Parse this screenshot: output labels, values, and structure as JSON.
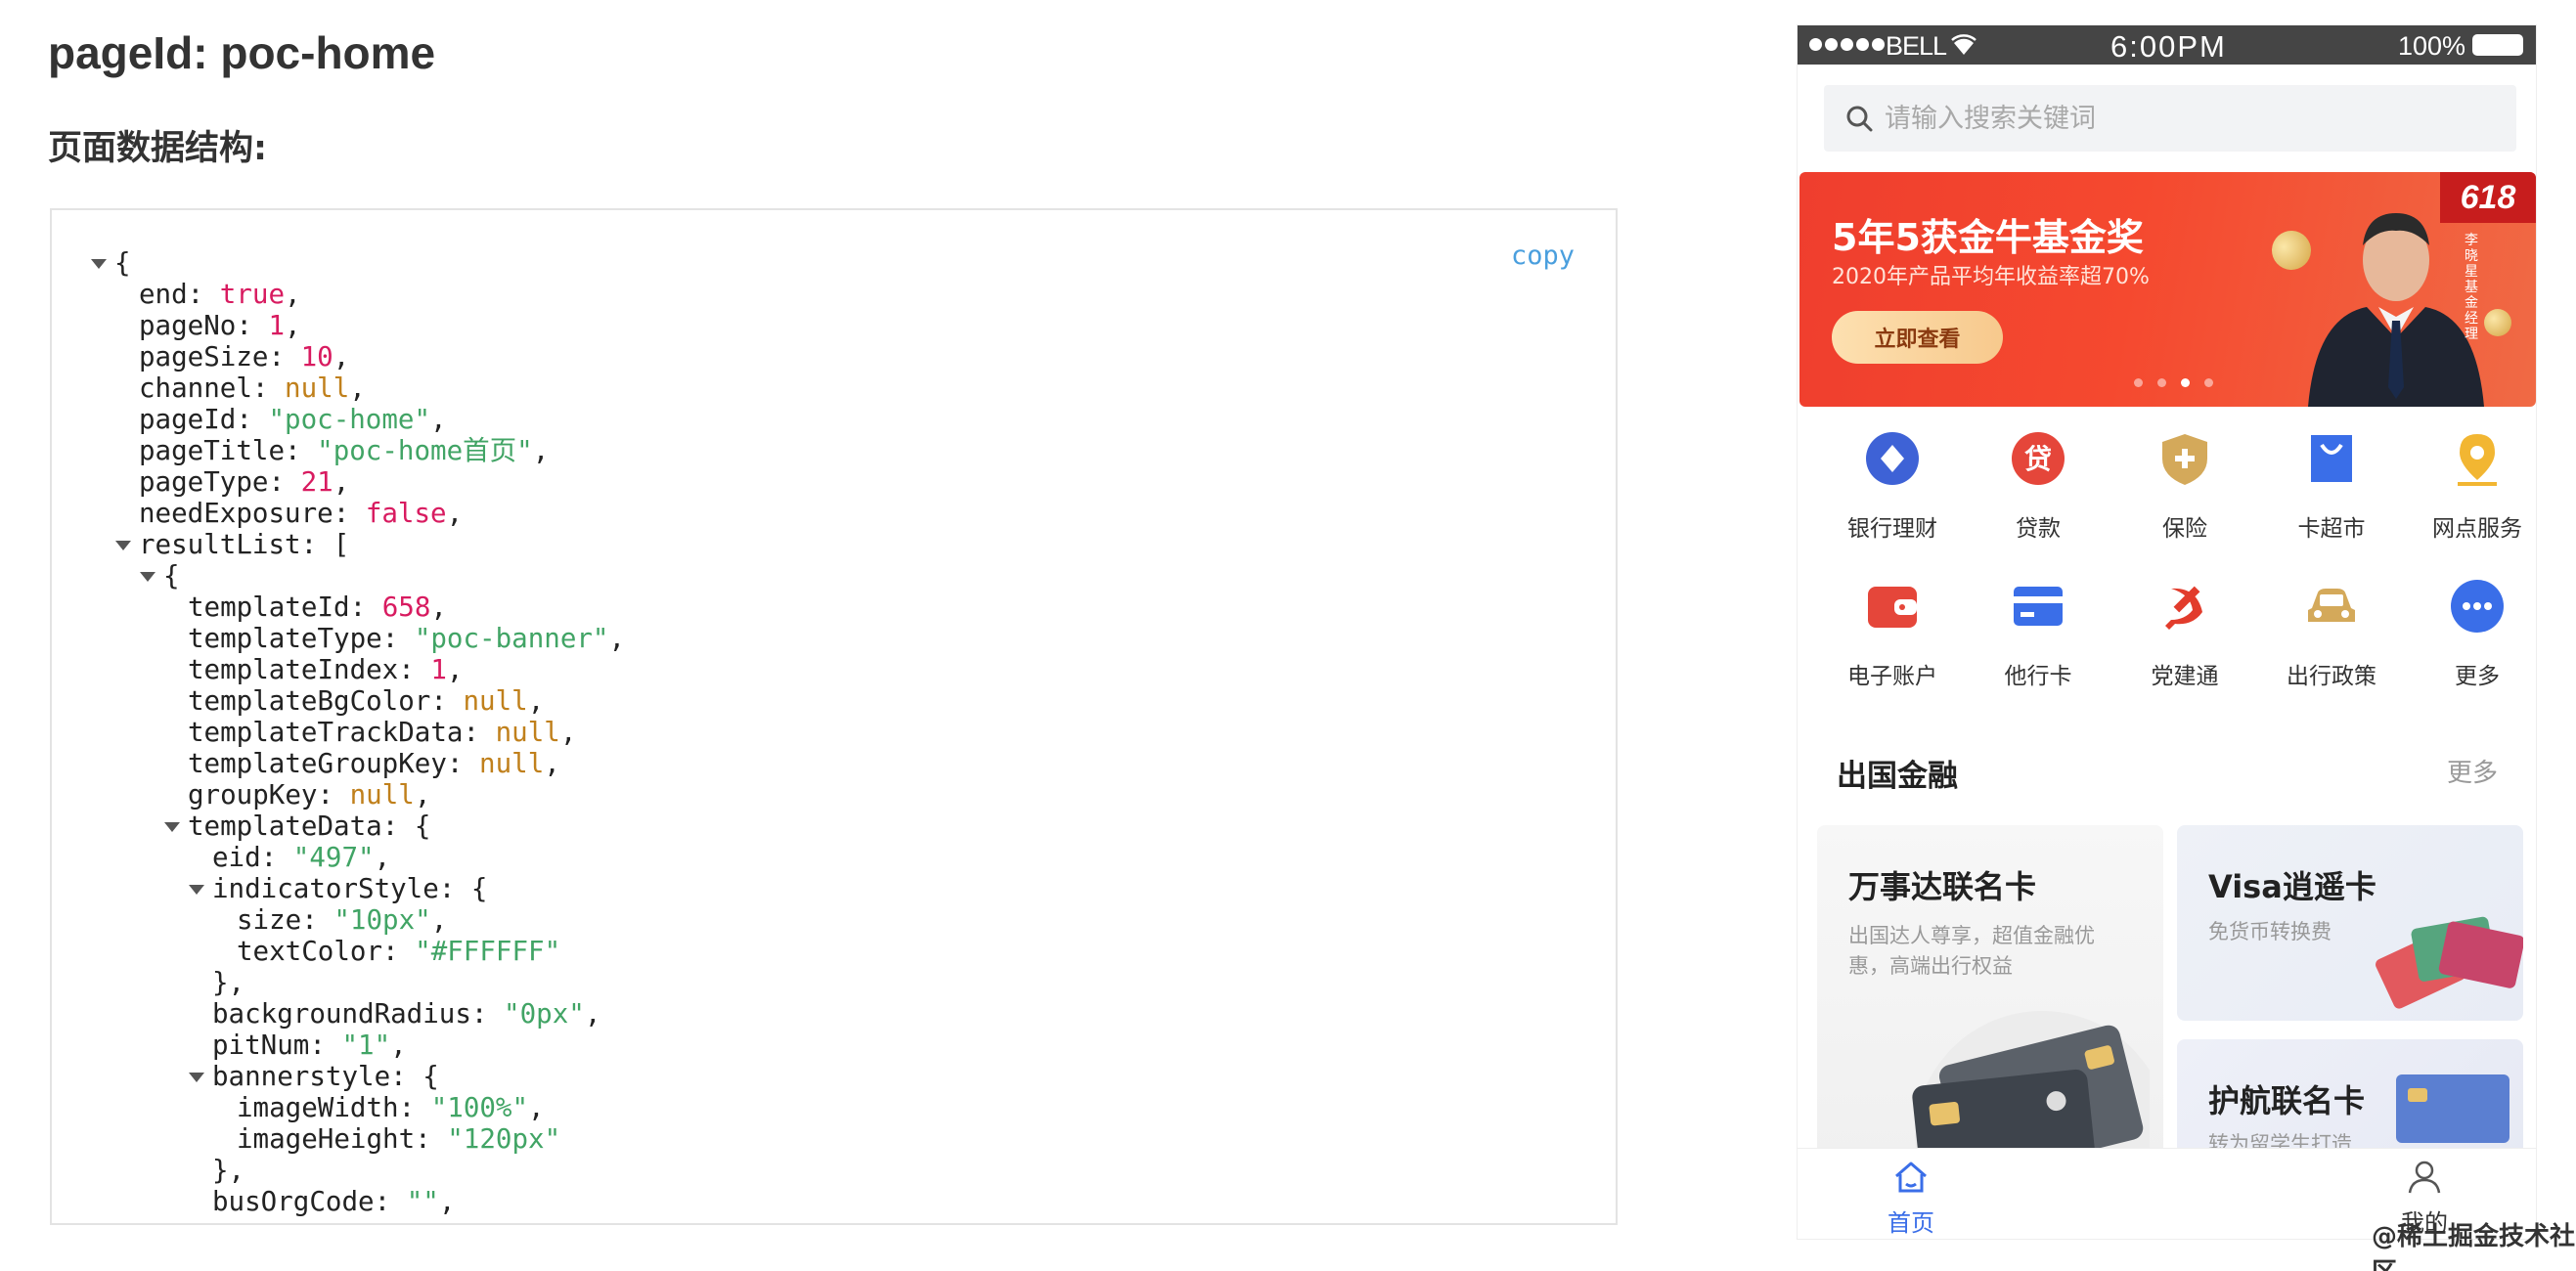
{
  "doc": {
    "page_title": "pageId: poc-home",
    "section_title": "页面数据结构:",
    "copy_label": "copy"
  },
  "json_lines": [
    {
      "indent": 0,
      "toggle": true,
      "key": "",
      "value": "",
      "type": "open",
      "text": "{"
    },
    {
      "indent": 1,
      "key": "end",
      "value": "true",
      "type": "bool",
      "comma": true
    },
    {
      "indent": 1,
      "key": "pageNo",
      "value": "1",
      "type": "num",
      "comma": true
    },
    {
      "indent": 1,
      "key": "pageSize",
      "value": "10",
      "type": "num",
      "comma": true
    },
    {
      "indent": 1,
      "key": "channel",
      "value": "null",
      "type": "null",
      "comma": true
    },
    {
      "indent": 1,
      "key": "pageId",
      "value": "\"poc-home\"",
      "type": "str",
      "comma": true
    },
    {
      "indent": 1,
      "key": "pageTitle",
      "value": "\"poc-home首页\"",
      "type": "str",
      "comma": true
    },
    {
      "indent": 1,
      "key": "pageType",
      "value": "21",
      "type": "num",
      "comma": true
    },
    {
      "indent": 1,
      "key": "needExposure",
      "value": "false",
      "type": "bool",
      "comma": true
    },
    {
      "indent": 1,
      "toggle": true,
      "key": "resultList",
      "value": "[",
      "type": "open"
    },
    {
      "indent": 2,
      "toggle": true,
      "key": "",
      "value": "",
      "type": "open",
      "text": "{"
    },
    {
      "indent": 3,
      "key": "templateId",
      "value": "658",
      "type": "num",
      "comma": true
    },
    {
      "indent": 3,
      "key": "templateType",
      "value": "\"poc-banner\"",
      "type": "str",
      "comma": true
    },
    {
      "indent": 3,
      "key": "templateIndex",
      "value": "1",
      "type": "num",
      "comma": true
    },
    {
      "indent": 3,
      "key": "templateBgColor",
      "value": "null",
      "type": "null",
      "comma": true
    },
    {
      "indent": 3,
      "key": "templateTrackData",
      "value": "null",
      "type": "null",
      "comma": true
    },
    {
      "indent": 3,
      "key": "templateGroupKey",
      "value": "null",
      "type": "null",
      "comma": true
    },
    {
      "indent": 3,
      "key": "groupKey",
      "value": "null",
      "type": "null",
      "comma": true
    },
    {
      "indent": 3,
      "toggle": true,
      "key": "templateData",
      "value": "{",
      "type": "open"
    },
    {
      "indent": 4,
      "key": "eid",
      "value": "\"497\"",
      "type": "str",
      "comma": true
    },
    {
      "indent": 4,
      "toggle": true,
      "key": "indicatorStyle",
      "value": "{",
      "type": "open"
    },
    {
      "indent": 5,
      "key": "size",
      "value": "\"10px\"",
      "type": "str",
      "comma": true
    },
    {
      "indent": 5,
      "key": "textColor",
      "value": "\"#FFFFFF\"",
      "type": "str",
      "comma": false
    },
    {
      "indent": 4,
      "key": "",
      "value": "",
      "type": "close",
      "text": "},"
    },
    {
      "indent": 4,
      "key": "backgroundRadius",
      "value": "\"0px\"",
      "type": "str",
      "comma": true
    },
    {
      "indent": 4,
      "key": "pitNum",
      "value": "\"1\"",
      "type": "str",
      "comma": true
    },
    {
      "indent": 4,
      "toggle": true,
      "key": "bannerstyle",
      "value": "{",
      "type": "open"
    },
    {
      "indent": 5,
      "key": "imageWidth",
      "value": "\"100%\"",
      "type": "str",
      "comma": true
    },
    {
      "indent": 5,
      "key": "imageHeight",
      "value": "\"120px\"",
      "type": "str",
      "comma": false
    },
    {
      "indent": 4,
      "key": "",
      "value": "",
      "type": "close",
      "text": "},"
    },
    {
      "indent": 4,
      "key": "busOrgCode",
      "value": "\"\"",
      "type": "str",
      "comma": true
    }
  ],
  "phone": {
    "status": {
      "carrier": "BELL",
      "time": "6:00PM",
      "battery": "100%"
    },
    "search": {
      "placeholder": "请输入搜索关键词"
    },
    "banner": {
      "title": "5年5获金牛基金奖",
      "subtitle": "2020年产品平均年收益率超70%",
      "cta": "立即查看",
      "badge": "618",
      "manager_label": "李晓星 基金经理",
      "slides": 4,
      "active_slide": 3
    },
    "grid": [
      {
        "label": "银行理财",
        "icon": "diamond-icon",
        "color": "#3e62d6"
      },
      {
        "label": "贷款",
        "icon": "loan-icon",
        "color": "#e5463a"
      },
      {
        "label": "保险",
        "icon": "shield-plus-icon",
        "color": "#d4a95a"
      },
      {
        "label": "卡超市",
        "icon": "shopping-bag-icon",
        "color": "#3a6ee8"
      },
      {
        "label": "网点服务",
        "icon": "location-pin-icon",
        "color": "#f2b632"
      },
      {
        "label": "电子账户",
        "icon": "wallet-icon",
        "color": "#e5463a"
      },
      {
        "label": "他行卡",
        "icon": "bank-card-icon",
        "color": "#3a6ee8"
      },
      {
        "label": "党建通",
        "icon": "hammer-sickle-icon",
        "color": "#e23c2c"
      },
      {
        "label": "出行政策",
        "icon": "car-icon",
        "color": "#d4a95a"
      },
      {
        "label": "更多",
        "icon": "more-icon",
        "color": "#3a6ee8"
      }
    ],
    "section": {
      "title": "出国金融",
      "more": "更多"
    },
    "cards": {
      "mastercard": {
        "title": "万事达联名卡",
        "desc": "出国达人尊享，超值金融优惠，高端出行权益"
      },
      "visa": {
        "title": "Visa逍遥卡",
        "desc": "免货币转换费"
      },
      "passport": {
        "title": "护航联名卡",
        "desc": "转为留学生打造"
      }
    },
    "tabs": [
      {
        "label": "首页",
        "active": true
      },
      {
        "label": "我的",
        "active": false
      }
    ]
  },
  "watermark": "@稀土掘金技术社区",
  "colors": {
    "accent": "#3a6ee8",
    "banner": "#ef3e2e",
    "json_string": "#41a465",
    "json_number": "#d81b60",
    "json_null": "#c0801c",
    "copy": "#4a9fde"
  }
}
